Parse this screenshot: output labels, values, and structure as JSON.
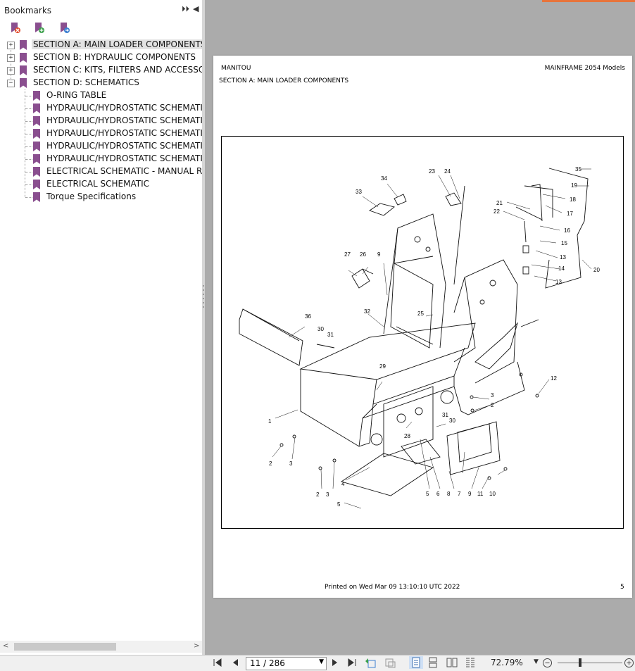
{
  "panel": {
    "title": "Bookmarks",
    "header_buttons": [
      "⏵⏵",
      "◀"
    ],
    "toolbar_icons": [
      "delete-bookmark-icon",
      "add-bookmark-icon",
      "go-to-bookmark-icon"
    ]
  },
  "bookmarks": [
    {
      "label": "SECTION A: MAIN LOADER COMPONENTS",
      "level": 0,
      "expander": "+",
      "selected": true
    },
    {
      "label": "SECTION B: HYDRAULIC COMPONENTS",
      "level": 0,
      "expander": "+"
    },
    {
      "label": "SECTION C:  KITS, FILTERS AND ACCESSOF",
      "level": 0,
      "expander": "+"
    },
    {
      "label": "SECTION D: SCHEMATICS",
      "level": 0,
      "expander": "−"
    },
    {
      "label": "O-RING TABLE",
      "level": 1
    },
    {
      "label": "HYDRAULIC/HYDROSTATIC SCHEMATIC",
      "level": 1
    },
    {
      "label": "HYDRAULIC/HYDROSTATIC SCHEMATIC",
      "level": 1
    },
    {
      "label": "HYDRAULIC/HYDROSTATIC SCHEMATIC",
      "level": 1
    },
    {
      "label": "HYDRAULIC/HYDROSTATIC SCHEMATIC",
      "level": 1
    },
    {
      "label": "HYDRAULIC/HYDROSTATIC SCHEMATIC",
      "level": 1
    },
    {
      "label": "ELECTRICAL SCHEMATIC - MANUAL REL",
      "level": 1
    },
    {
      "label": "ELECTRICAL SCHEMATIC",
      "level": 1
    },
    {
      "label": "Torque Specifications",
      "level": 1
    }
  ],
  "document": {
    "brand": "MANITOU",
    "models": "MAINFRAME 2054 Models",
    "section": "SECTION A: MAIN LOADER COMPONENTS",
    "printed": "Printed on  Wed Mar 09 13:10:10 UTC 2022",
    "page_number": "5",
    "callouts": [
      "1",
      "2",
      "3",
      "2",
      "3",
      "4",
      "5",
      "5",
      "6",
      "8",
      "7",
      "9",
      "11",
      "10",
      "12",
      "3",
      "2",
      "30",
      "31",
      "28",
      "29",
      "30",
      "31",
      "32",
      "25",
      "36",
      "27",
      "26",
      "9",
      "33",
      "34",
      "23",
      "24",
      "35",
      "19",
      "18",
      "17",
      "21",
      "22",
      "16",
      "15",
      "13",
      "14",
      "13",
      "20"
    ]
  },
  "bottombar": {
    "page_indicator": "11 / 286",
    "zoom": "72.79%",
    "zoom_fraction": 0.33,
    "accent_color": "#e8743b",
    "bookmark_color": "#8a4f8f"
  }
}
